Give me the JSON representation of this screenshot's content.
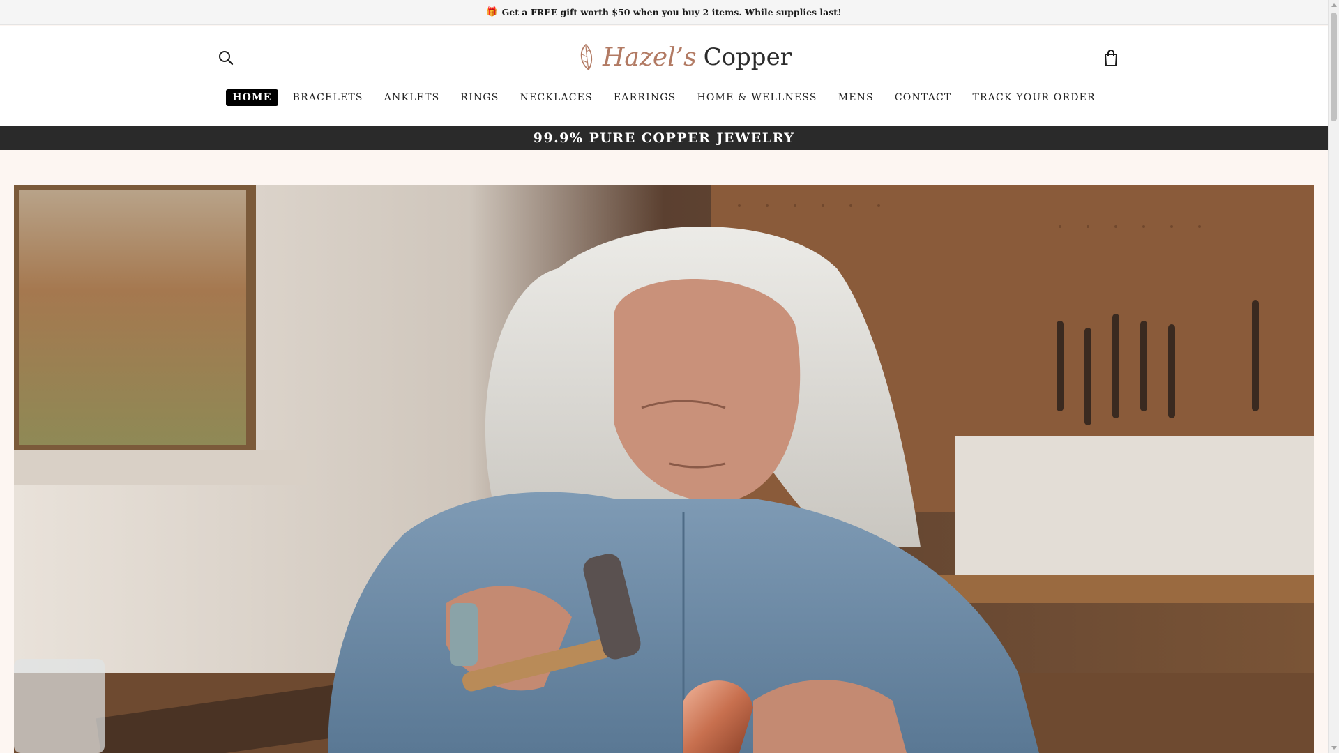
{
  "announcement": {
    "icon": "gift-icon",
    "text": "Get a FREE gift worth $50 when you buy 2 items. While supplies last!"
  },
  "header": {
    "logo": {
      "script_part": "Hazel’s",
      "text_part": "Copper",
      "accent_color": "#b27a63"
    },
    "search_icon": "search-icon",
    "cart_icon": "shopping-bag-icon"
  },
  "nav": {
    "items": [
      {
        "label": "HOME",
        "active": true
      },
      {
        "label": "BRACELETS"
      },
      {
        "label": "ANKLETS"
      },
      {
        "label": "RINGS"
      },
      {
        "label": "NECKLACES"
      },
      {
        "label": "EARRINGS"
      },
      {
        "label": "HOME & WELLNESS"
      },
      {
        "label": "MENS"
      },
      {
        "label": "CONTACT"
      },
      {
        "label": "TRACK YOUR ORDER"
      }
    ]
  },
  "subbar": {
    "text": "99.9% PURE COPPER JEWELRY"
  },
  "colors": {
    "subbar_bg": "#2a2a2a",
    "page_bg": "#fdf6f2",
    "announce_bg": "#f5f5f5"
  }
}
